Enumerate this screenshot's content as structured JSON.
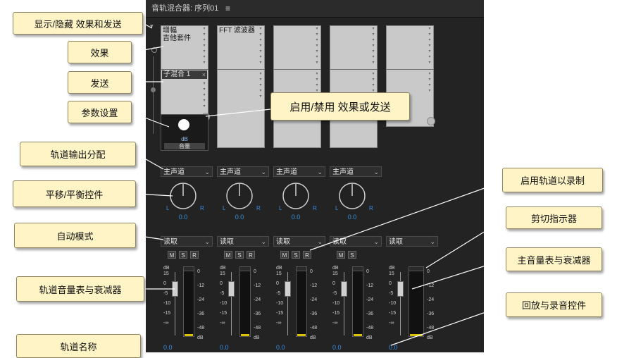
{
  "panel": {
    "title": "音轨混合器: 序列01",
    "menu_glyph": "≡"
  },
  "strips": [
    {
      "fx_text": "增幅\n吉他套件",
      "send_label": "子混合 1",
      "send_close": "×",
      "param_db": "dB",
      "param_bar": "音量",
      "output": "主声道",
      "pan_value": "0.0",
      "pan_left": "L",
      "pan_right": "R",
      "automation": "读取",
      "buttons": [
        "M",
        "S",
        "R"
      ],
      "volume_value": "0.0"
    },
    {
      "fx_text": "FFT 滤波器",
      "output": "主声道",
      "pan_value": "0.0",
      "pan_left": "L",
      "pan_right": "R",
      "automation": "读取",
      "buttons": [
        "M",
        "S",
        "R"
      ],
      "volume_value": "0.0"
    },
    {
      "fx_text": "",
      "output": "主声道",
      "pan_value": "0.0",
      "pan_left": "L",
      "pan_right": "R",
      "automation": "读取",
      "buttons": [
        "M",
        "S",
        "R"
      ],
      "volume_value": "0.0"
    },
    {
      "fx_text": "",
      "output": "主声道",
      "pan_value": "0.0",
      "pan_left": "L",
      "pan_right": "R",
      "automation": "读取",
      "buttons": [
        "M",
        "S"
      ],
      "volume_value": "0.0"
    },
    {
      "fx_text": "",
      "automation": "读取",
      "volume_value": "0.0"
    }
  ],
  "fader_scale": [
    "dB",
    "15",
    "0",
    "-5",
    "-10",
    "-15",
    "-∞"
  ],
  "meter_scale": [
    "0",
    "-12",
    "-24",
    "-36",
    "-48",
    "dB"
  ],
  "chevron": "⌄",
  "callouts": {
    "show_hide": "显示/隐藏 效果和发送",
    "effects": "效果",
    "sends": "发送",
    "params": "参数设置",
    "enable_disable": "启用/禁用 效果或发送",
    "output_assign": "轨道输出分配",
    "pan": "平移/平衡控件",
    "automation": "自动模式",
    "track_meter": "轨道音量表与衰减器",
    "track_name": "轨道名称",
    "record_enable": "启用轨道以录制",
    "clip_indicator": "剪切指示器",
    "master_meter": "主音量表与衰减器",
    "playback": "回放与录音控件"
  }
}
